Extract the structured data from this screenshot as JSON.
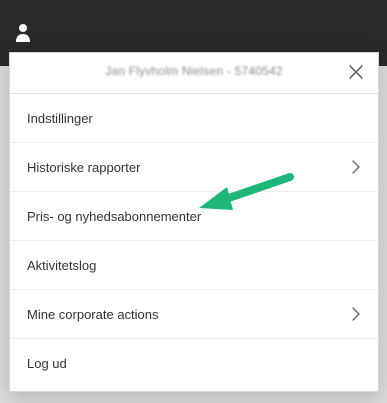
{
  "header": {
    "user_icon": "user-icon"
  },
  "menu": {
    "user_name": "Jan Flyvholm Nielsen - 5740542",
    "close_icon": "close-icon",
    "items": [
      {
        "label": "Indstillinger",
        "has_submenu": false
      },
      {
        "label": "Historiske rapporter",
        "has_submenu": true
      },
      {
        "label": "Pris- og nyhedsabonnementer",
        "has_submenu": false
      },
      {
        "label": "Aktivitetslog",
        "has_submenu": false
      },
      {
        "label": "Mine corporate actions",
        "has_submenu": true
      },
      {
        "label": "Log ud",
        "has_submenu": false
      }
    ]
  },
  "annotation": {
    "arrow_color": "#1fb67a",
    "arrow_icon": "arrow-pointer-icon"
  },
  "colors": {
    "topbar": "#2a2a2a",
    "menu_bg": "#ffffff",
    "text": "#333333"
  }
}
